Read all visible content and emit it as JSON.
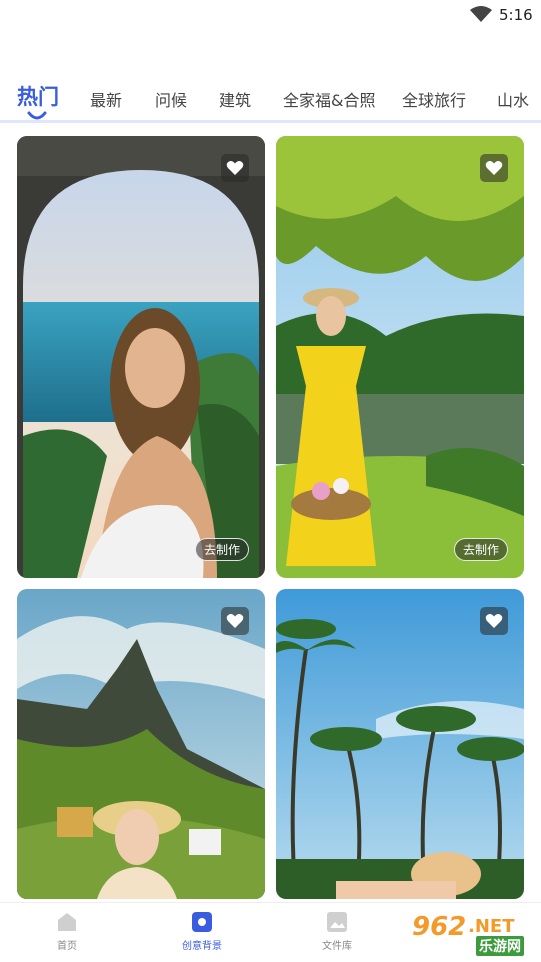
{
  "status": {
    "time": "5:16",
    "wifi_icon": "wifi-icon"
  },
  "tabs": [
    {
      "label": "热门",
      "active": true
    },
    {
      "label": "最新"
    },
    {
      "label": "问候"
    },
    {
      "label": "建筑"
    },
    {
      "label": "全家福&合照"
    },
    {
      "label": "全球旅行"
    },
    {
      "label": "山水"
    }
  ],
  "cards": [
    {
      "make_label": "去制作",
      "favorite_icon": "heart-icon",
      "scene": "woman-at-arch-over-sea"
    },
    {
      "make_label": "去制作",
      "favorite_icon": "heart-icon",
      "scene": "girl-in-yellow-dress-by-lake"
    },
    {
      "favorite_icon": "heart-icon",
      "scene": "mountain-peak-with-girl"
    },
    {
      "favorite_icon": "heart-icon",
      "scene": "palm-trees-beach"
    }
  ],
  "bottom_nav": [
    {
      "label": "首页",
      "icon": "home-icon"
    },
    {
      "label": "创意背景",
      "icon": "creative-icon",
      "active": true
    },
    {
      "label": "文件库",
      "icon": "gallery-icon"
    }
  ],
  "watermark": {
    "number": "962",
    "suffix": ".NET",
    "site": "乐游网"
  },
  "colors": {
    "accent": "#3a5de0",
    "divider": "#dfe6ff"
  }
}
